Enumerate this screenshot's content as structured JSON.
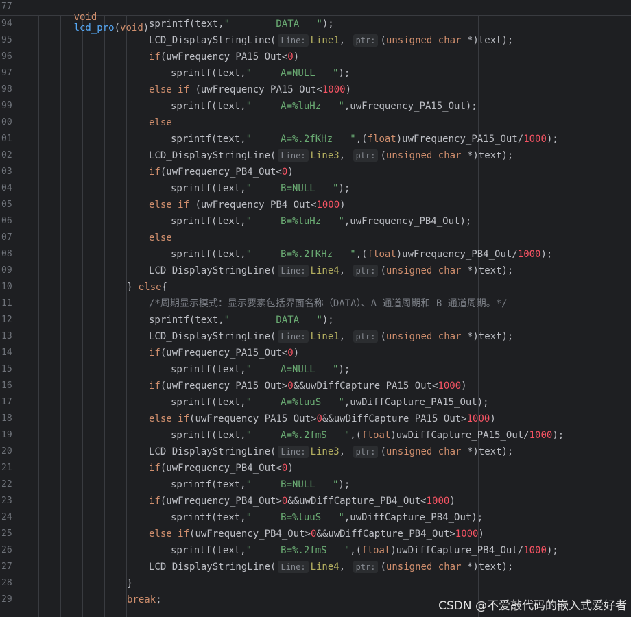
{
  "sticky_header": {
    "line_number": "77",
    "parts": [
      "void",
      "lcd_pro",
      "(",
      "void",
      ")"
    ]
  },
  "hints": {
    "line": "Line:",
    "ptr": "ptr:"
  },
  "watermark": "CSDN @不爱敲代码的嵌入式爱好者",
  "lines": [
    {
      "n": "94",
      "indent": 5,
      "tokens": [
        [
          "id",
          "sprintf(text,"
        ],
        [
          "str",
          "\"        DATA   \""
        ],
        [
          "id",
          ");"
        ]
      ]
    },
    {
      "n": "95",
      "indent": 5,
      "tokens": [
        [
          "id",
          "LCD_DisplayStringLine("
        ],
        [
          "hint",
          "Line:"
        ],
        [
          "macro",
          "Line1"
        ],
        [
          "id",
          ", "
        ],
        [
          "hint",
          "ptr:"
        ],
        [
          "id",
          "("
        ],
        [
          "kw",
          "unsigned char"
        ],
        [
          "id",
          " *)text);"
        ]
      ]
    },
    {
      "n": "96",
      "indent": 5,
      "tokens": [
        [
          "kw",
          "if"
        ],
        [
          "id",
          "(uwFrequency_PA15_Out<"
        ],
        [
          "num",
          "0"
        ],
        [
          "id",
          ")"
        ]
      ]
    },
    {
      "n": "97",
      "indent": 6,
      "tokens": [
        [
          "id",
          "sprintf(text,"
        ],
        [
          "str",
          "\"     A=NULL   \""
        ],
        [
          "id",
          ");"
        ]
      ]
    },
    {
      "n": "98",
      "indent": 5,
      "tokens": [
        [
          "kw",
          "else if "
        ],
        [
          "id",
          "(uwFrequency_PA15_Out<"
        ],
        [
          "num",
          "1000"
        ],
        [
          "id",
          ")"
        ]
      ]
    },
    {
      "n": "99",
      "indent": 6,
      "tokens": [
        [
          "id",
          "sprintf(text,"
        ],
        [
          "str",
          "\"     A=%luHz   \""
        ],
        [
          "id",
          ",uwFrequency_PA15_Out);"
        ]
      ]
    },
    {
      "n": "00",
      "indent": 5,
      "tokens": [
        [
          "kw",
          "else"
        ]
      ]
    },
    {
      "n": "01",
      "indent": 6,
      "tokens": [
        [
          "id",
          "sprintf(text,"
        ],
        [
          "str",
          "\"     A=%.2fKHz   \""
        ],
        [
          "id",
          ",("
        ],
        [
          "kw",
          "float"
        ],
        [
          "id",
          ")uwFrequency_PA15_Out/"
        ],
        [
          "num",
          "1000"
        ],
        [
          "id",
          ");"
        ]
      ]
    },
    {
      "n": "02",
      "indent": 5,
      "tokens": [
        [
          "id",
          "LCD_DisplayStringLine("
        ],
        [
          "hint",
          "Line:"
        ],
        [
          "macro",
          "Line3"
        ],
        [
          "id",
          ", "
        ],
        [
          "hint",
          "ptr:"
        ],
        [
          "id",
          "("
        ],
        [
          "kw",
          "unsigned char"
        ],
        [
          "id",
          " *)text);"
        ]
      ]
    },
    {
      "n": "03",
      "indent": 5,
      "tokens": [
        [
          "kw",
          "if"
        ],
        [
          "id",
          "(uwFrequency_PB4_Out<"
        ],
        [
          "num",
          "0"
        ],
        [
          "id",
          ")"
        ]
      ]
    },
    {
      "n": "04",
      "indent": 6,
      "tokens": [
        [
          "id",
          "sprintf(text,"
        ],
        [
          "str",
          "\"     B=NULL   \""
        ],
        [
          "id",
          ");"
        ]
      ]
    },
    {
      "n": "05",
      "indent": 5,
      "tokens": [
        [
          "kw",
          "else if "
        ],
        [
          "id",
          "(uwFrequency_PB4_Out<"
        ],
        [
          "num",
          "1000"
        ],
        [
          "id",
          ")"
        ]
      ]
    },
    {
      "n": "06",
      "indent": 6,
      "tokens": [
        [
          "id",
          "sprintf(text,"
        ],
        [
          "str",
          "\"     B=%luHz   \""
        ],
        [
          "id",
          ",uwFrequency_PB4_Out);"
        ]
      ]
    },
    {
      "n": "07",
      "indent": 5,
      "tokens": [
        [
          "kw",
          "else"
        ]
      ]
    },
    {
      "n": "08",
      "indent": 6,
      "tokens": [
        [
          "id",
          "sprintf(text,"
        ],
        [
          "str",
          "\"     B=%.2fKHz   \""
        ],
        [
          "id",
          ",("
        ],
        [
          "kw",
          "float"
        ],
        [
          "id",
          ")uwFrequency_PB4_Out/"
        ],
        [
          "num",
          "1000"
        ],
        [
          "id",
          ");"
        ]
      ]
    },
    {
      "n": "09",
      "indent": 5,
      "tokens": [
        [
          "id",
          "LCD_DisplayStringLine("
        ],
        [
          "hint",
          "Line:"
        ],
        [
          "macro",
          "Line4"
        ],
        [
          "id",
          ", "
        ],
        [
          "hint",
          "ptr:"
        ],
        [
          "id",
          "("
        ],
        [
          "kw",
          "unsigned char"
        ],
        [
          "id",
          " *)text);"
        ]
      ]
    },
    {
      "n": "10",
      "indent": 4,
      "tokens": [
        [
          "id",
          "} "
        ],
        [
          "kw",
          "else"
        ],
        [
          "id",
          "{"
        ]
      ]
    },
    {
      "n": "11",
      "indent": 5,
      "tokens": [
        [
          "com",
          "/*周期显示模式：显示要素包括界面名称（DATA）、A 通道周期和 B 通道周期。*/"
        ]
      ]
    },
    {
      "n": "12",
      "indent": 5,
      "tokens": [
        [
          "id",
          "sprintf(text,"
        ],
        [
          "str",
          "\"        DATA   \""
        ],
        [
          "id",
          ");"
        ]
      ]
    },
    {
      "n": "13",
      "indent": 5,
      "tokens": [
        [
          "id",
          "LCD_DisplayStringLine("
        ],
        [
          "hint",
          "Line:"
        ],
        [
          "macro",
          "Line1"
        ],
        [
          "id",
          ", "
        ],
        [
          "hint",
          "ptr:"
        ],
        [
          "id",
          "("
        ],
        [
          "kw",
          "unsigned char"
        ],
        [
          "id",
          " *)text);"
        ]
      ]
    },
    {
      "n": "14",
      "indent": 5,
      "tokens": [
        [
          "kw",
          "if"
        ],
        [
          "id",
          "(uwFrequency_PA15_Out<"
        ],
        [
          "num",
          "0"
        ],
        [
          "id",
          ")"
        ]
      ]
    },
    {
      "n": "15",
      "indent": 6,
      "tokens": [
        [
          "id",
          "sprintf(text,"
        ],
        [
          "str",
          "\"     A=NULL   \""
        ],
        [
          "id",
          ");"
        ]
      ]
    },
    {
      "n": "16",
      "indent": 5,
      "tokens": [
        [
          "kw",
          "if"
        ],
        [
          "id",
          "(uwFrequency_PA15_Out>"
        ],
        [
          "num",
          "0"
        ],
        [
          "id",
          "&&uwDiffCapture_PA15_Out<"
        ],
        [
          "num",
          "1000"
        ],
        [
          "id",
          ")"
        ]
      ]
    },
    {
      "n": "17",
      "indent": 6,
      "tokens": [
        [
          "id",
          "sprintf(text,"
        ],
        [
          "str",
          "\"     A=%luuS   \""
        ],
        [
          "id",
          ",uwDiffCapture_PA15_Out);"
        ]
      ]
    },
    {
      "n": "18",
      "indent": 5,
      "tokens": [
        [
          "kw",
          "else if"
        ],
        [
          "id",
          "(uwFrequency_PA15_Out>"
        ],
        [
          "num",
          "0"
        ],
        [
          "id",
          "&&uwDiffCapture_PA15_Out>"
        ],
        [
          "num",
          "1000"
        ],
        [
          "id",
          ")"
        ]
      ]
    },
    {
      "n": "19",
      "indent": 6,
      "tokens": [
        [
          "id",
          "sprintf(text,"
        ],
        [
          "str",
          "\"     A=%.2fmS   \""
        ],
        [
          "id",
          ",("
        ],
        [
          "kw",
          "float"
        ],
        [
          "id",
          ")uwDiffCapture_PA15_Out/"
        ],
        [
          "num",
          "1000"
        ],
        [
          "id",
          ");"
        ]
      ]
    },
    {
      "n": "20",
      "indent": 5,
      "tokens": [
        [
          "id",
          "LCD_DisplayStringLine("
        ],
        [
          "hint",
          "Line:"
        ],
        [
          "macro",
          "Line3"
        ],
        [
          "id",
          ", "
        ],
        [
          "hint",
          "ptr:"
        ],
        [
          "id",
          "("
        ],
        [
          "kw",
          "unsigned char"
        ],
        [
          "id",
          " *)text);"
        ]
      ]
    },
    {
      "n": "21",
      "indent": 5,
      "tokens": [
        [
          "kw",
          "if"
        ],
        [
          "id",
          "(uwFrequency_PB4_Out<"
        ],
        [
          "num",
          "0"
        ],
        [
          "id",
          ")"
        ]
      ]
    },
    {
      "n": "22",
      "indent": 6,
      "tokens": [
        [
          "id",
          "sprintf(text,"
        ],
        [
          "str",
          "\"     B=NULL   \""
        ],
        [
          "id",
          ");"
        ]
      ]
    },
    {
      "n": "23",
      "indent": 5,
      "tokens": [
        [
          "kw",
          "if"
        ],
        [
          "id",
          "(uwFrequency_PB4_Out>"
        ],
        [
          "num",
          "0"
        ],
        [
          "id",
          "&&uwDiffCapture_PB4_Out<"
        ],
        [
          "num",
          "1000"
        ],
        [
          "id",
          ")"
        ]
      ]
    },
    {
      "n": "24",
      "indent": 6,
      "tokens": [
        [
          "id",
          "sprintf(text,"
        ],
        [
          "str",
          "\"     B=%luuS   \""
        ],
        [
          "id",
          ",uwDiffCapture_PB4_Out);"
        ]
      ]
    },
    {
      "n": "25",
      "indent": 5,
      "tokens": [
        [
          "kw",
          "else if"
        ],
        [
          "id",
          "(uwFrequency_PB4_Out>"
        ],
        [
          "num",
          "0"
        ],
        [
          "id",
          "&&uwDiffCapture_PB4_Out>"
        ],
        [
          "num",
          "1000"
        ],
        [
          "id",
          ")"
        ]
      ]
    },
    {
      "n": "26",
      "indent": 6,
      "tokens": [
        [
          "id",
          "sprintf(text,"
        ],
        [
          "str",
          "\"     B=%.2fmS   \""
        ],
        [
          "id",
          ",("
        ],
        [
          "kw",
          "float"
        ],
        [
          "id",
          ")uwDiffCapture_PB4_Out/"
        ],
        [
          "num",
          "1000"
        ],
        [
          "id",
          ");"
        ]
      ]
    },
    {
      "n": "27",
      "indent": 5,
      "tokens": [
        [
          "id",
          "LCD_DisplayStringLine("
        ],
        [
          "hint",
          "Line:"
        ],
        [
          "macro",
          "Line4"
        ],
        [
          "id",
          ", "
        ],
        [
          "hint",
          "ptr:"
        ],
        [
          "id",
          "("
        ],
        [
          "kw",
          "unsigned char"
        ],
        [
          "id",
          " *)text);"
        ]
      ]
    },
    {
      "n": "28",
      "indent": 4,
      "tokens": [
        [
          "id",
          "}"
        ]
      ]
    },
    {
      "n": "29",
      "indent": 4,
      "tokens": [
        [
          "kw",
          "break"
        ],
        [
          "id",
          ";"
        ]
      ]
    }
  ]
}
